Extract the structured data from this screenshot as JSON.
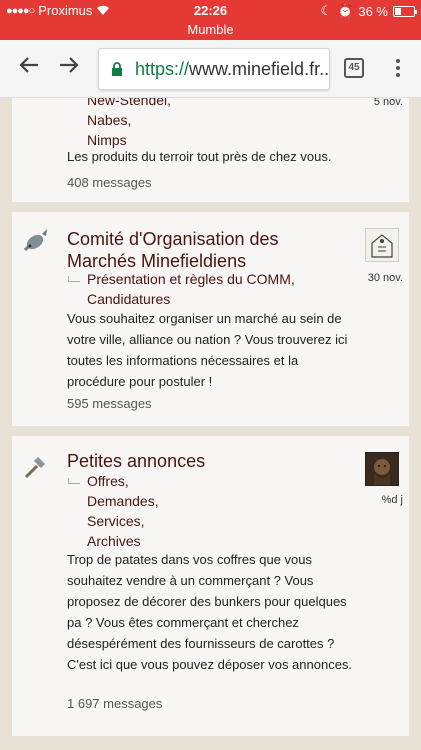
{
  "status": {
    "carrier": "Proximus",
    "time": "22:26",
    "battery": "36 %",
    "battery_level": 0.36
  },
  "app": {
    "title": "Mumble"
  },
  "browser": {
    "url_scheme": "https://",
    "url_rest": "www.minefield.fr...",
    "tab_count": "45",
    "icons": [
      "back-arrow-icon",
      "forward-arrow-icon",
      "lock-icon",
      "tab-switcher-icon",
      "overflow-menu-icon"
    ]
  },
  "forums": [
    {
      "subforums": [
        "New-Stendel,",
        "Nabes,",
        "Nimps"
      ],
      "description": "Les produits du terroir tout près de chez vous.",
      "count": "408 messages",
      "last_date": "5 nov."
    },
    {
      "title": "Comité d'Organisation des Marchés Minefieldiens",
      "subforums": [
        "Présentation et règles du COMM,",
        "Candidatures"
      ],
      "description": "Vous souhaitez organiser un marché au sein de votre ville, alliance ou nation ? Vous trouverez ici toutes les informations nécessaires et la procédure pour postuler !",
      "count": "595 messages",
      "last_date": "30 nov.",
      "icon": "fish-icon"
    },
    {
      "title": "Petites annonces",
      "subforums": [
        "Offres,",
        "Demandes,",
        "Services,",
        "Archives"
      ],
      "description": "Trop de patates dans vos coffres que vous souhaitez vendre à un commerçant ? Vous proposez de décorer des bunkers pour quelques pa ? Vous êtes commerçant et cherchez désespérément des fournisseurs de carottes ? C'est ici que vous pouvez déposer vos annonces.",
      "count": "1 697 messages",
      "last_date": "%d j",
      "icon": "hammer-icon"
    }
  ]
}
